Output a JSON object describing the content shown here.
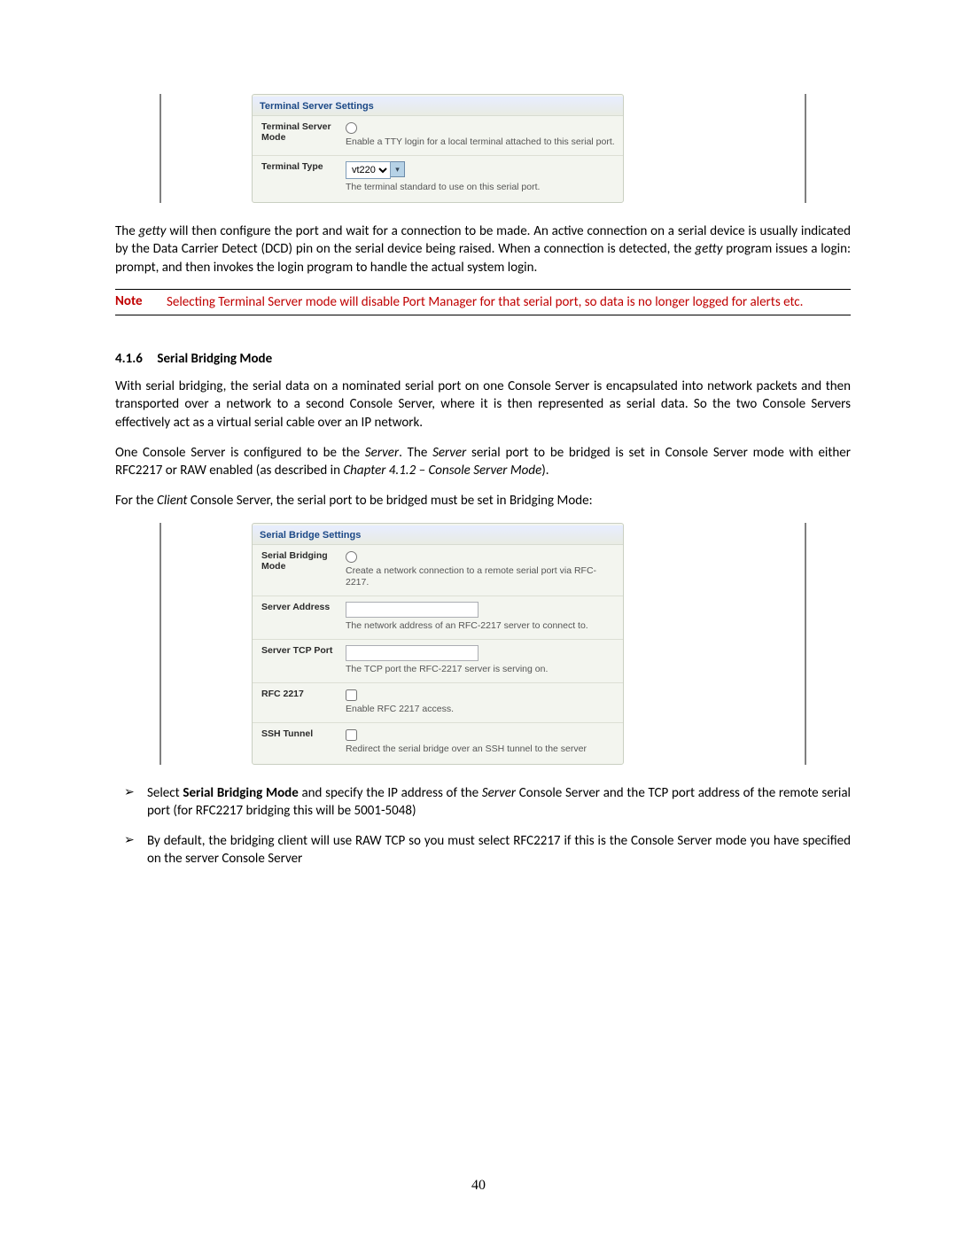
{
  "panel1": {
    "title": "Terminal Server Settings",
    "rows": {
      "mode": {
        "label": "Terminal Server Mode",
        "desc": "Enable a TTY login for a local terminal attached to this serial port."
      },
      "type": {
        "label": "Terminal Type",
        "select_value": "vt220",
        "desc": "The terminal standard to use on this serial port."
      }
    }
  },
  "para1_a": "The ",
  "para1_getty": "getty",
  "para1_b": " will then configure the port and wait for a connection to be made. An active connection on a serial device is usually indicated by the Data Carrier Detect (DCD) pin on the serial device being raised. When a connection is detected, the ",
  "para1_c": " program issues a login: prompt, and then invokes the login program to handle the actual system login.",
  "note": {
    "label": "Note",
    "text": "Selecting Terminal Server mode will disable Port Manager for that serial port, so data is no longer logged for alerts etc."
  },
  "section": {
    "num": "4.1.6",
    "title": "Serial Bridging Mode"
  },
  "para2": "With serial bridging, the serial data on a nominated serial port on one Console Server is encapsulated into network packets and then transported over a network to a second Console Server, where it is then represented as serial data. So the two Console Servers effectively act as a virtual serial cable over an IP network.",
  "para3_a": "One Console Server is configured to be the ",
  "para3_server": "Server",
  "para3_b": ". The ",
  "para3_c": " serial port to be bridged is set in Console Server mode with either RFC2217 or RAW enabled (as described in ",
  "para3_chap": "Chapter 4.1.2 – Console Server Mode",
  "para3_d": ").",
  "para4_a": "For the ",
  "para4_client": "Client",
  "para4_b": " Console Server, the serial port to be bridged must be set in Bridging Mode:",
  "panel2": {
    "title": "Serial Bridge Settings",
    "rows": {
      "mode": {
        "label": "Serial Bridging Mode",
        "desc": "Create a network connection to a remote serial port via RFC-2217."
      },
      "addr": {
        "label": "Server Address",
        "desc": "The network address of an RFC-2217 server to connect to."
      },
      "port": {
        "label": "Server TCP Port",
        "desc": "The TCP port the RFC-2217 server is serving on."
      },
      "rfc": {
        "label": "RFC 2217",
        "desc": "Enable RFC 2217 access."
      },
      "ssh": {
        "label": "SSH Tunnel",
        "desc": "Redirect the serial bridge over an SSH tunnel to the server"
      }
    }
  },
  "bullets": {
    "b1_a": "Select ",
    "b1_bold": "Serial Bridging Mode",
    "b1_b": " and specify the IP address of the ",
    "b1_server": "Server",
    "b1_c": " Console Server and the TCP port address of the remote serial port (for RFC2217 bridging this will be 5001-5048)",
    "b2": "By default, the bridging client will use RAW TCP so you must select RFC2217 if this is the Console Server mode you have specified on the server Console Server"
  },
  "pagenum": "40"
}
